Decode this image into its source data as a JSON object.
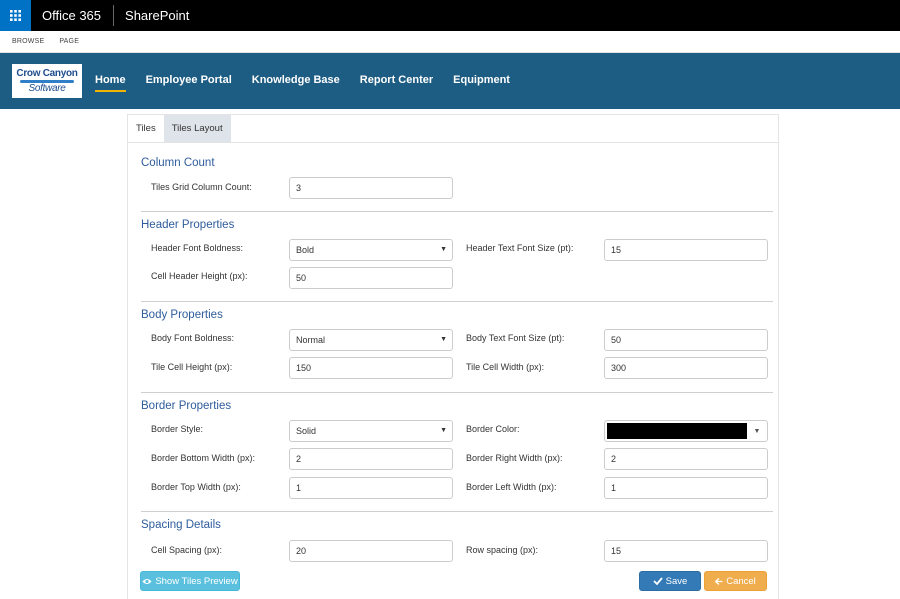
{
  "suitebar": {
    "app_launcher_icon": "waffle-icon",
    "title": "Office 365",
    "app": "SharePoint"
  },
  "ribbon": {
    "tabs": [
      "BROWSE",
      "PAGE"
    ]
  },
  "nav": {
    "logo_line1": "Crow Canyon",
    "logo_line2": "Software",
    "items": [
      "Home",
      "Employee Portal",
      "Knowledge Base",
      "Report Center",
      "Equipment"
    ]
  },
  "tabs": [
    "Tiles",
    "Tiles Layout"
  ],
  "sections": {
    "column_count": {
      "title": "Column Count",
      "grid_column_count_label": "Tiles Grid Column Count:",
      "grid_column_count_value": "3"
    },
    "header": {
      "title": "Header Properties",
      "font_boldness_label": "Header Font Boldness:",
      "font_boldness_value": "Bold",
      "text_font_size_label": "Header Text Font Size (pt):",
      "text_font_size_value": "15",
      "cell_height_label": "Cell Header Height (px):",
      "cell_height_value": "50"
    },
    "body": {
      "title": "Body Properties",
      "font_boldness_label": "Body Font Boldness:",
      "font_boldness_value": "Normal",
      "text_font_size_label": "Body Text Font Size (pt):",
      "text_font_size_value": "50",
      "cell_height_label": "Tile Cell Height (px):",
      "cell_height_value": "150",
      "cell_width_label": "Tile Cell Width (px):",
      "cell_width_value": "300"
    },
    "border": {
      "title": "Border Properties",
      "style_label": "Border Style:",
      "style_value": "Solid",
      "color_label": "Border Color:",
      "color_value": "#000000",
      "bottom_width_label": "Border Bottom Width (px):",
      "bottom_width_value": "2",
      "right_width_label": "Border Right Width (px):",
      "right_width_value": "2",
      "top_width_label": "Border Top Width (px):",
      "top_width_value": "1",
      "left_width_label": "Border Left Width (px):",
      "left_width_value": "1"
    },
    "spacing": {
      "title": "Spacing Details",
      "cell_spacing_label": "Cell Spacing (px):",
      "cell_spacing_value": "20",
      "row_spacing_label": "Row spacing (px):",
      "row_spacing_value": "15"
    }
  },
  "buttons": {
    "preview_label": "Show Tiles Preview",
    "preview_icon": "eye-icon",
    "save_label": "Save",
    "save_icon": "check-icon",
    "cancel_label": "Cancel",
    "cancel_icon": "arrow-left-icon"
  }
}
